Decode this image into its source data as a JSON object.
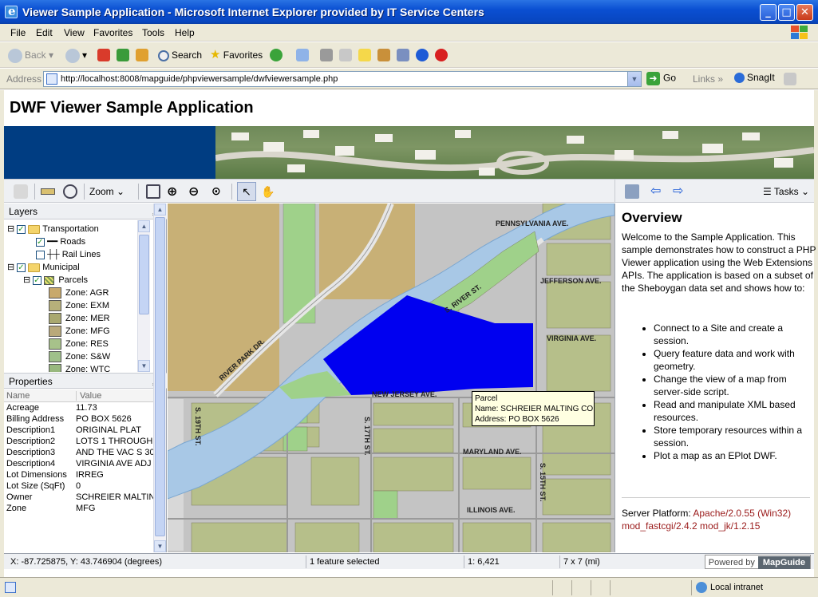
{
  "window": {
    "title": "Viewer Sample Application - Microsoft Internet Explorer provided by IT Service Centers",
    "minimize": "_",
    "maximize": "□",
    "close": "✕"
  },
  "menu": [
    "File",
    "Edit",
    "View",
    "Favorites",
    "Tools",
    "Help"
  ],
  "toolbar": {
    "back": "Back",
    "search": "Search",
    "favorites": "Favorites"
  },
  "address": {
    "label": "Address",
    "url": "http://localhost:8008/mapguide/phpviewersample/dwfviewersample.php",
    "go": "Go",
    "links": "Links",
    "snagit": "SnagIt"
  },
  "page": {
    "title": "DWF Viewer Sample Application"
  },
  "viewer_toolbar": {
    "zoom_label": "Zoom"
  },
  "layers_panel": {
    "title": "Layers",
    "items": [
      {
        "label": "Transportation",
        "kind": "group"
      },
      {
        "label": "Roads",
        "kind": "layer"
      },
      {
        "label": "Rail Lines",
        "kind": "layer"
      },
      {
        "label": "Municipal",
        "kind": "group"
      },
      {
        "label": "Parcels",
        "kind": "layer"
      },
      {
        "label": "Zone:  AGR",
        "kind": "legend",
        "color": "#c8a96b"
      },
      {
        "label": "Zone:  EXM",
        "kind": "legend",
        "color": "#b7b07a"
      },
      {
        "label": "Zone:  MER",
        "kind": "legend",
        "color": "#a9a86f"
      },
      {
        "label": "Zone:  MFG",
        "kind": "legend",
        "color": "#b9a97a"
      },
      {
        "label": "Zone:  RES",
        "kind": "legend",
        "color": "#a7c28a"
      },
      {
        "label": "Zone:  S&W",
        "kind": "legend",
        "color": "#9fc08a"
      },
      {
        "label": "Zone:  WTC",
        "kind": "legend",
        "color": "#98b87e"
      }
    ]
  },
  "properties_panel": {
    "title": "Properties",
    "col_name": "Name",
    "col_value": "Value",
    "rows": [
      {
        "name": "Acreage",
        "value": "11.73"
      },
      {
        "name": "Billing Address",
        "value": "PO BOX 5626"
      },
      {
        "name": "Description1",
        "value": "ORIGINAL PLAT"
      },
      {
        "name": "Description2",
        "value": "LOTS 1 THROUGH"
      },
      {
        "name": "Description3",
        "value": "AND THE VAC S 30"
      },
      {
        "name": "Description4",
        "value": "VIRGINIA AVE ADJ"
      },
      {
        "name": "Lot Dimensions",
        "value": "IRREG"
      },
      {
        "name": "Lot Size (SqFt)",
        "value": "0"
      },
      {
        "name": "Owner",
        "value": "SCHREIER MALTIN"
      },
      {
        "name": "Zone",
        "value": "MFG"
      }
    ]
  },
  "map": {
    "street_labels": {
      "pennsylvania": "PENNSYLVANIA AVE.",
      "jefferson": "JEFFERSON AVE.",
      "s_river": "S. RIVER ST.",
      "river_park": "RIVER PARK DR.",
      "virginia": "VIRGINIA AVE.",
      "new_jersey": "NEW JERSEY AVE.",
      "s_19th": "S. 19TH ST.",
      "s_17th": "S. 17TH ST.",
      "maryland": "MARYLAND AVE.",
      "s_15th": "S. 15TH ST.",
      "illinois": "ILLINOIS AVE."
    },
    "tooltip": {
      "line1": "Parcel",
      "line2": "Name: SCHREIER MALTING CO",
      "line3": "Address: PO BOX 5626"
    },
    "colors": {
      "water": "#a8c8e6",
      "selected": "#0000f0",
      "road": "#c8c8c8",
      "park": "#9fd18a"
    }
  },
  "task_pane": {
    "tasks_label": "Tasks",
    "title": "Overview",
    "intro": "Welcome to the Sample Application. This sample demonstrates how to construct a PHP Viewer application using the Web Extensions APIs. The application is based on a subset of the Sheboygan data set and shows how to:",
    "bullets": [
      "Connect to a Site and create a session.",
      "Query feature data and work with geometry.",
      "Change the view of a map from server-side script.",
      "Read and manipulate XML based resources.",
      "Store temporary resources within a session.",
      "Plot a map as an EPlot DWF."
    ],
    "server_label": "Server Platform:",
    "server_value": "Apache/2.0.55 (Win32) mod_fastcgi/2.4.2 mod_jk/1.2.15"
  },
  "status": {
    "coords": "X: -87.725875, Y: 43.746904 (degrees)",
    "selection": "1 feature selected",
    "scale": "1: 6,421",
    "size": "7 x 7 (mi)",
    "powered_by": "Powered by",
    "brand": "MapGuide"
  },
  "ie_status": {
    "zone": "Local intranet"
  }
}
